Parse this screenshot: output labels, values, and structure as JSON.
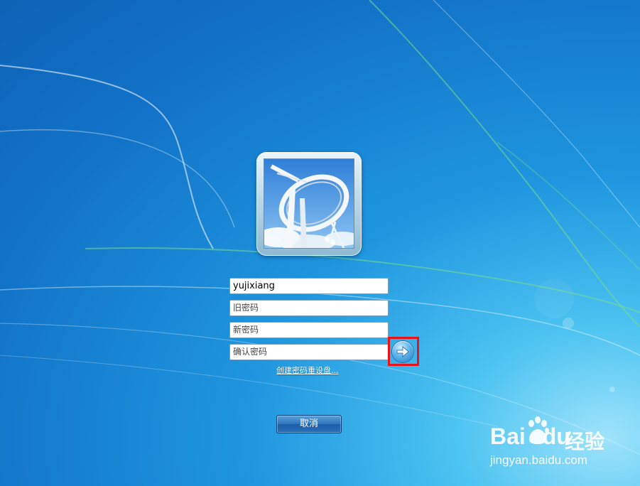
{
  "login": {
    "username": "yujixiang",
    "old_password_placeholder": "旧密码",
    "new_password_placeholder": "新密码",
    "confirm_password_placeholder": "确认密码",
    "submit_icon": "arrow-right-icon",
    "reset_disk_link": "创建密码重设盘...",
    "cancel_label": "取消"
  },
  "watermark": {
    "brand_latin": "Bai",
    "brand_latin_tail": "du",
    "brand_cn": "经验",
    "url": "jingyan.baidu.com"
  },
  "colors": {
    "highlight": "#e8141c",
    "wallpaper_blue": "#1273c8",
    "wallpaper_glow": "#9fe3fb"
  }
}
